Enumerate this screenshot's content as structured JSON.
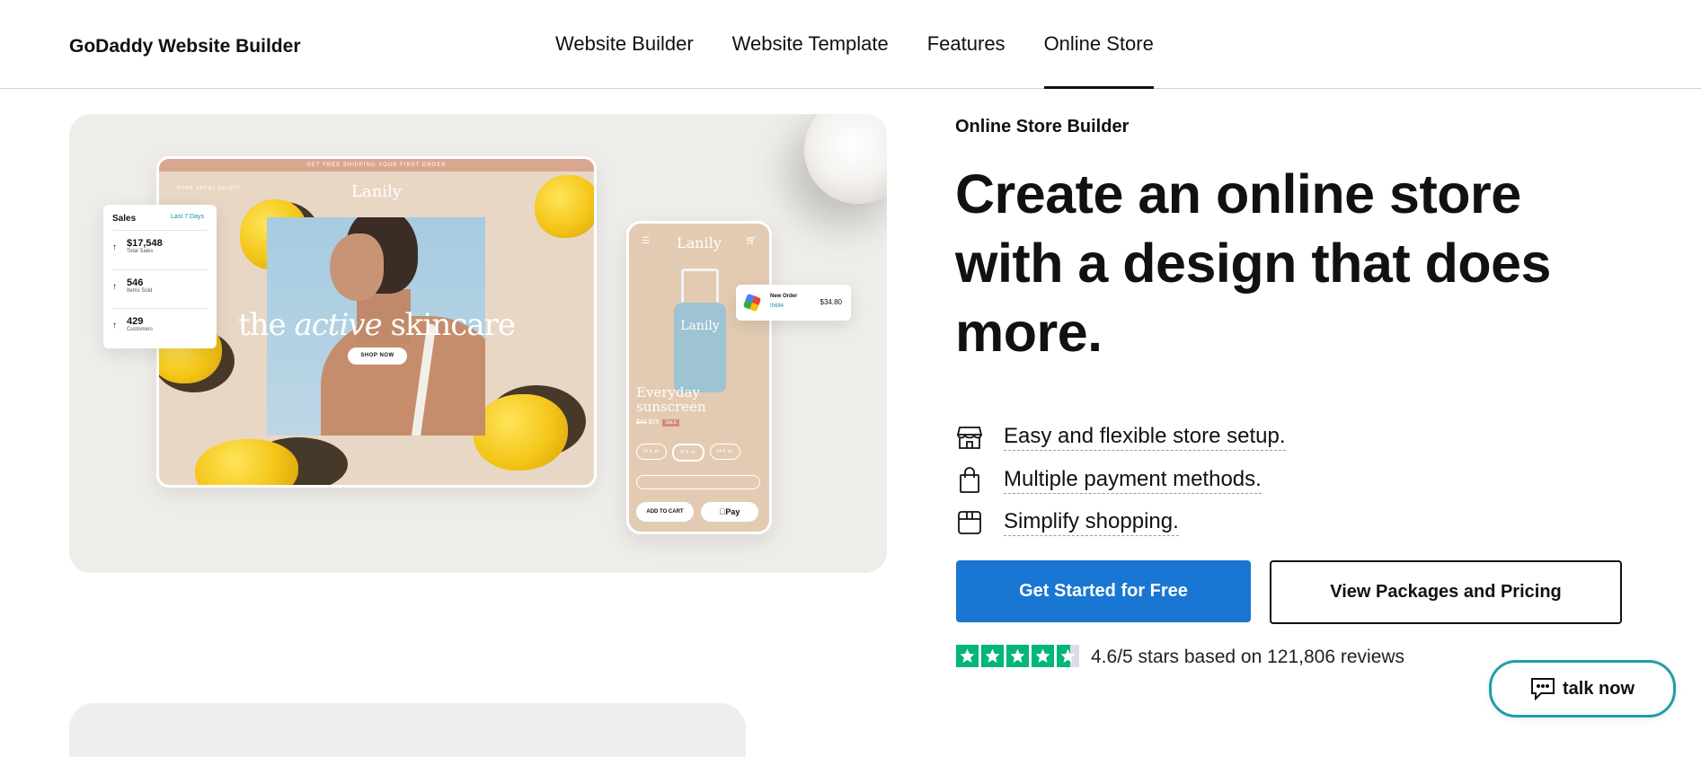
{
  "header": {
    "brand": "GoDaddy Website Builder",
    "nav": [
      {
        "label": "Website Builder"
      },
      {
        "label": "Website Template"
      },
      {
        "label": "Features"
      },
      {
        "label": "Online Store",
        "active": true
      }
    ]
  },
  "mockup": {
    "banner": "GET FREE SHIPPING YOUR FIRST ORDER",
    "desktop_nav": "HOME   ABOUT   SELECT",
    "logo": "Lanily",
    "headline_pre": "the ",
    "headline_italic": "active",
    "headline_post": " skincare",
    "shop_now": "SHOP NOW",
    "sales": {
      "title": "Sales",
      "period": "Last 7 Days",
      "stats": [
        {
          "value": "$17,548",
          "label": "Total Sales"
        },
        {
          "value": "546",
          "label": "Items Sold"
        },
        {
          "value": "429",
          "label": "Customers"
        }
      ]
    },
    "phone": {
      "logo": "Lanily",
      "bottle_label": "Lanily",
      "product_title": "Everyday sunscreen",
      "old_price": "$40",
      "new_price": "$25",
      "sale": "SALE",
      "sizes": [
        "16 fl. oz.",
        "20 fl. oz.",
        "24 fl. oz."
      ],
      "add_to_cart": "ADD TO CART",
      "apple_pay": "Pay"
    },
    "order": {
      "title": "New Order",
      "subtitle": "I5684",
      "amount": "$34.80"
    }
  },
  "hero": {
    "eyebrow": "Online Store Builder",
    "title": "Create an online store with a design that does more.",
    "features": [
      {
        "icon": "store-icon",
        "text": "Easy and flexible store setup."
      },
      {
        "icon": "shopping-bag-icon",
        "text": "Multiple payment methods."
      },
      {
        "icon": "package-box-icon",
        "text": "Simplify shopping."
      }
    ],
    "primary_cta": "Get Started for Free",
    "secondary_cta": "View Packages and Pricing",
    "rating": {
      "stars": 4.6,
      "text": "4.6/5 stars based on 121,806 reviews"
    }
  },
  "chat": {
    "label": "talk now"
  },
  "colors": {
    "primary": "#1976d2",
    "chat_border": "#1f9ea8",
    "trustpilot_green": "#00b67a",
    "hero_bg": "#efedea"
  }
}
